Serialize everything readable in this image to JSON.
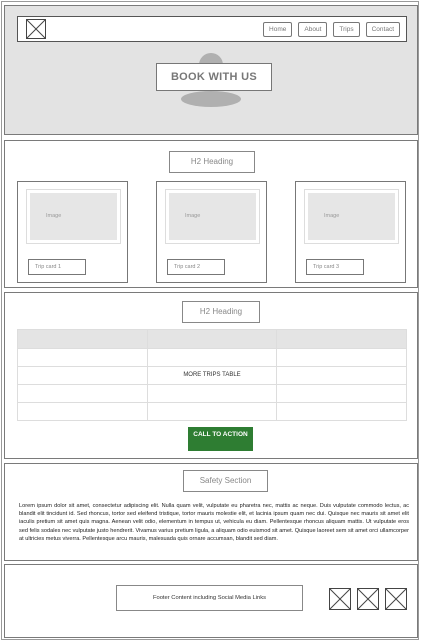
{
  "nav": {
    "logo_icon": "image-placeholder-icon",
    "links": [
      "Home",
      "About",
      "Trips",
      "Contact"
    ]
  },
  "hero": {
    "cta_label": "BOOK WITH US"
  },
  "trips": {
    "heading": "H2 Heading",
    "cards": [
      {
        "image_label": "Image",
        "label": "Trip card 1"
      },
      {
        "image_label": "Image",
        "label": "Trip card 2"
      },
      {
        "image_label": "Image",
        "label": "Trip card 3"
      }
    ]
  },
  "more_trips": {
    "heading": "H2 Heading",
    "table_label": "MORE TRIPS TABLE",
    "cta_label": "CALL TO ACTION",
    "cta_color": "#2e7d32"
  },
  "safety": {
    "heading": "Safety Section",
    "body": "Lorem ipsum dolor sit amet, consectetur adipiscing elit. Nulla quam velit, vulputate eu pharetra nec, mattis ac neque. Duis vulputate commodo lectus, ac blandit elit tincidunt id. Sed rhoncus, tortor sed eleifend tristique, tortor mauris molestie elit, et lacinia ipsum quam nec dui. Quisque nec mauris sit amet elit iaculis pretium sit amet quis magna. Aenean velit odio, elementum in tempus ut, vehicula eu diam. Pellentesque rhoncus aliquam mattis. Ut vulputate eros sed felis sodales nec vulputate justo hendrerit. Vivamus varius pretium ligula, a aliquam odio euismod sit amet. Quisque laoreet sem sit amet orci ullamcorper at ultricies metus viverra. Pellentesque arcu mauris, malesuada quis ornare accumsan, blandit sed diam."
  },
  "footer": {
    "content": "Footer Content including Social Media Links",
    "social_icons": [
      "social-placeholder-icon",
      "social-placeholder-icon",
      "social-placeholder-icon"
    ]
  }
}
